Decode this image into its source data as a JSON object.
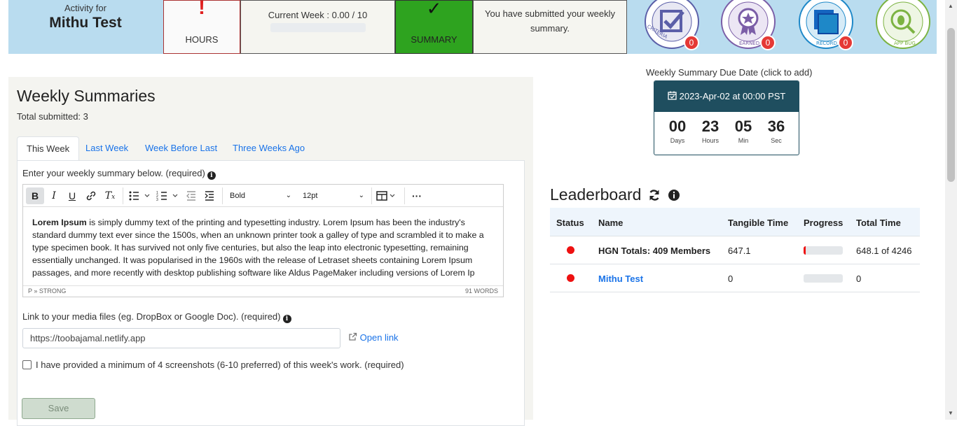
{
  "banner": {
    "activity_for": "Activity for",
    "user_name": "Mithu Test",
    "hours": {
      "mark": "!",
      "label": "HOURS"
    },
    "current_week": {
      "label": "Current Week : 0.00 / 10",
      "progress": 0
    },
    "summary": {
      "mark": "✓",
      "label": "SUMMARY"
    },
    "message": "You have submitted your weekly summary.",
    "badges": [
      {
        "icon": "criteria-badge-icon",
        "arc_text": "WHY CRITERIA ENDSTATE",
        "count": "0",
        "color": "#5b5fa8"
      },
      {
        "icon": "earned-badge-icon",
        "arc_text": "EARNED",
        "count": "0",
        "color": "#7b5ea7"
      },
      {
        "icon": "record-badge-icon",
        "arc_text": "BLUE SQUARE RECORD",
        "count": "0",
        "color": "#1e88c8"
      },
      {
        "icon": "app-bug-badge-icon",
        "arc_text": "APP BUG",
        "count": "",
        "color": "#7cb342"
      }
    ]
  },
  "summaries": {
    "title": "Weekly Summaries",
    "total": "Total submitted: 3",
    "tabs": [
      "This Week",
      "Last Week",
      "Week Before Last",
      "Three Weeks Ago"
    ],
    "editor_label": "Enter your weekly summary below. (required)",
    "toolbar": {
      "font_style": "Bold",
      "font_size": "12pt"
    },
    "content_lead": "Lorem Ipsum",
    "content_rest": " is simply dummy text of the printing and typesetting industry. Lorem Ipsum has been the industry's standard dummy text ever since the 1500s, when an unknown printer took a galley of type and scrambled it to make a type specimen book. It has survived not only five centuries, but also the leap into electronic typesetting, remaining essentially unchanged. It was popularised in the 1960s with the release of Letraset sheets containing Lorem Ipsum passages, and more recently with desktop publishing software like Aldus PageMaker including versions of Lorem Ip",
    "status_path": "P » STRONG",
    "word_count": "91 WORDS",
    "link_label": "Link to your media files (eg. DropBox or Google Doc). (required)",
    "link_value": "https://toobajamal.netlify.app",
    "open_link": "Open link",
    "screenshot_check": "I have provided a minimum of 4 screenshots (6-10 preferred) of this week's work. (required)",
    "save": "Save"
  },
  "due": {
    "label": "Weekly Summary Due Date (click to add)",
    "date": "2023-Apr-02 at 00:00 PST",
    "countdown": [
      {
        "num": "00",
        "unit": "Days"
      },
      {
        "num": "23",
        "unit": "Hours"
      },
      {
        "num": "05",
        "unit": "Min"
      },
      {
        "num": "36",
        "unit": "Sec"
      }
    ]
  },
  "leaderboard": {
    "title": "Leaderboard",
    "columns": [
      "Status",
      "Name",
      "Tangible Time",
      "Progress",
      "Total Time"
    ],
    "rows": [
      {
        "status_color": "#ee1111",
        "name": "HGN Totals: 409 Members",
        "tangible": "647.1",
        "progress": 0.05,
        "total": "648.1 of 4246"
      },
      {
        "status_color": "#ee1111",
        "name": "Mithu Test",
        "tangible": "0",
        "progress": 0,
        "total": "0"
      }
    ]
  }
}
